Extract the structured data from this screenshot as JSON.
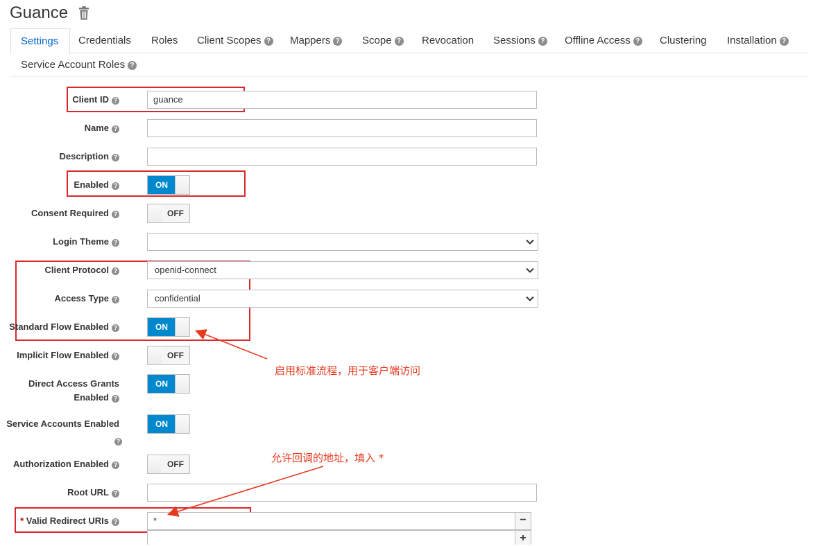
{
  "header": {
    "title": "Guance"
  },
  "tabs": [
    {
      "label": "Settings"
    },
    {
      "label": "Credentials"
    },
    {
      "label": "Roles"
    },
    {
      "label": "Client Scopes"
    },
    {
      "label": "Mappers"
    },
    {
      "label": "Scope"
    },
    {
      "label": "Revocation"
    },
    {
      "label": "Sessions"
    },
    {
      "label": "Offline Access"
    },
    {
      "label": "Clustering"
    },
    {
      "label": "Installation"
    },
    {
      "label": "Service Account Roles"
    }
  ],
  "form": {
    "client_id": {
      "label": "Client ID",
      "value": "guance"
    },
    "name": {
      "label": "Name",
      "value": ""
    },
    "description": {
      "label": "Description",
      "value": ""
    },
    "enabled": {
      "label": "Enabled",
      "state": "ON"
    },
    "consent_required": {
      "label": "Consent Required",
      "state": "OFF"
    },
    "login_theme": {
      "label": "Login Theme",
      "value": ""
    },
    "client_protocol": {
      "label": "Client Protocol",
      "value": "openid-connect"
    },
    "access_type": {
      "label": "Access Type",
      "value": "confidential"
    },
    "standard_flow": {
      "label": "Standard Flow Enabled",
      "state": "ON"
    },
    "implicit_flow": {
      "label": "Implicit Flow Enabled",
      "state": "OFF"
    },
    "direct_access": {
      "label_line1": "Direct Access Grants",
      "label_line2": "Enabled",
      "state": "ON"
    },
    "service_accounts": {
      "label": "Service Accounts Enabled",
      "state": "ON"
    },
    "authorization": {
      "label": "Authorization Enabled",
      "state": "OFF"
    },
    "root_url": {
      "label": "Root URL",
      "value": ""
    },
    "redirect_uris": {
      "required_mark": "*",
      "label": "Valid Redirect URIs",
      "value": "*",
      "remove": "−",
      "add": "+"
    }
  },
  "annotations": {
    "standard_flow_note": "启用标准流程，用于客户端访问",
    "redirect_note": "允许回调的地址，填入 *"
  },
  "colors": {
    "accent": "#0088ce",
    "annotation": "#e63a1e",
    "active_tab": "#0066cc"
  }
}
